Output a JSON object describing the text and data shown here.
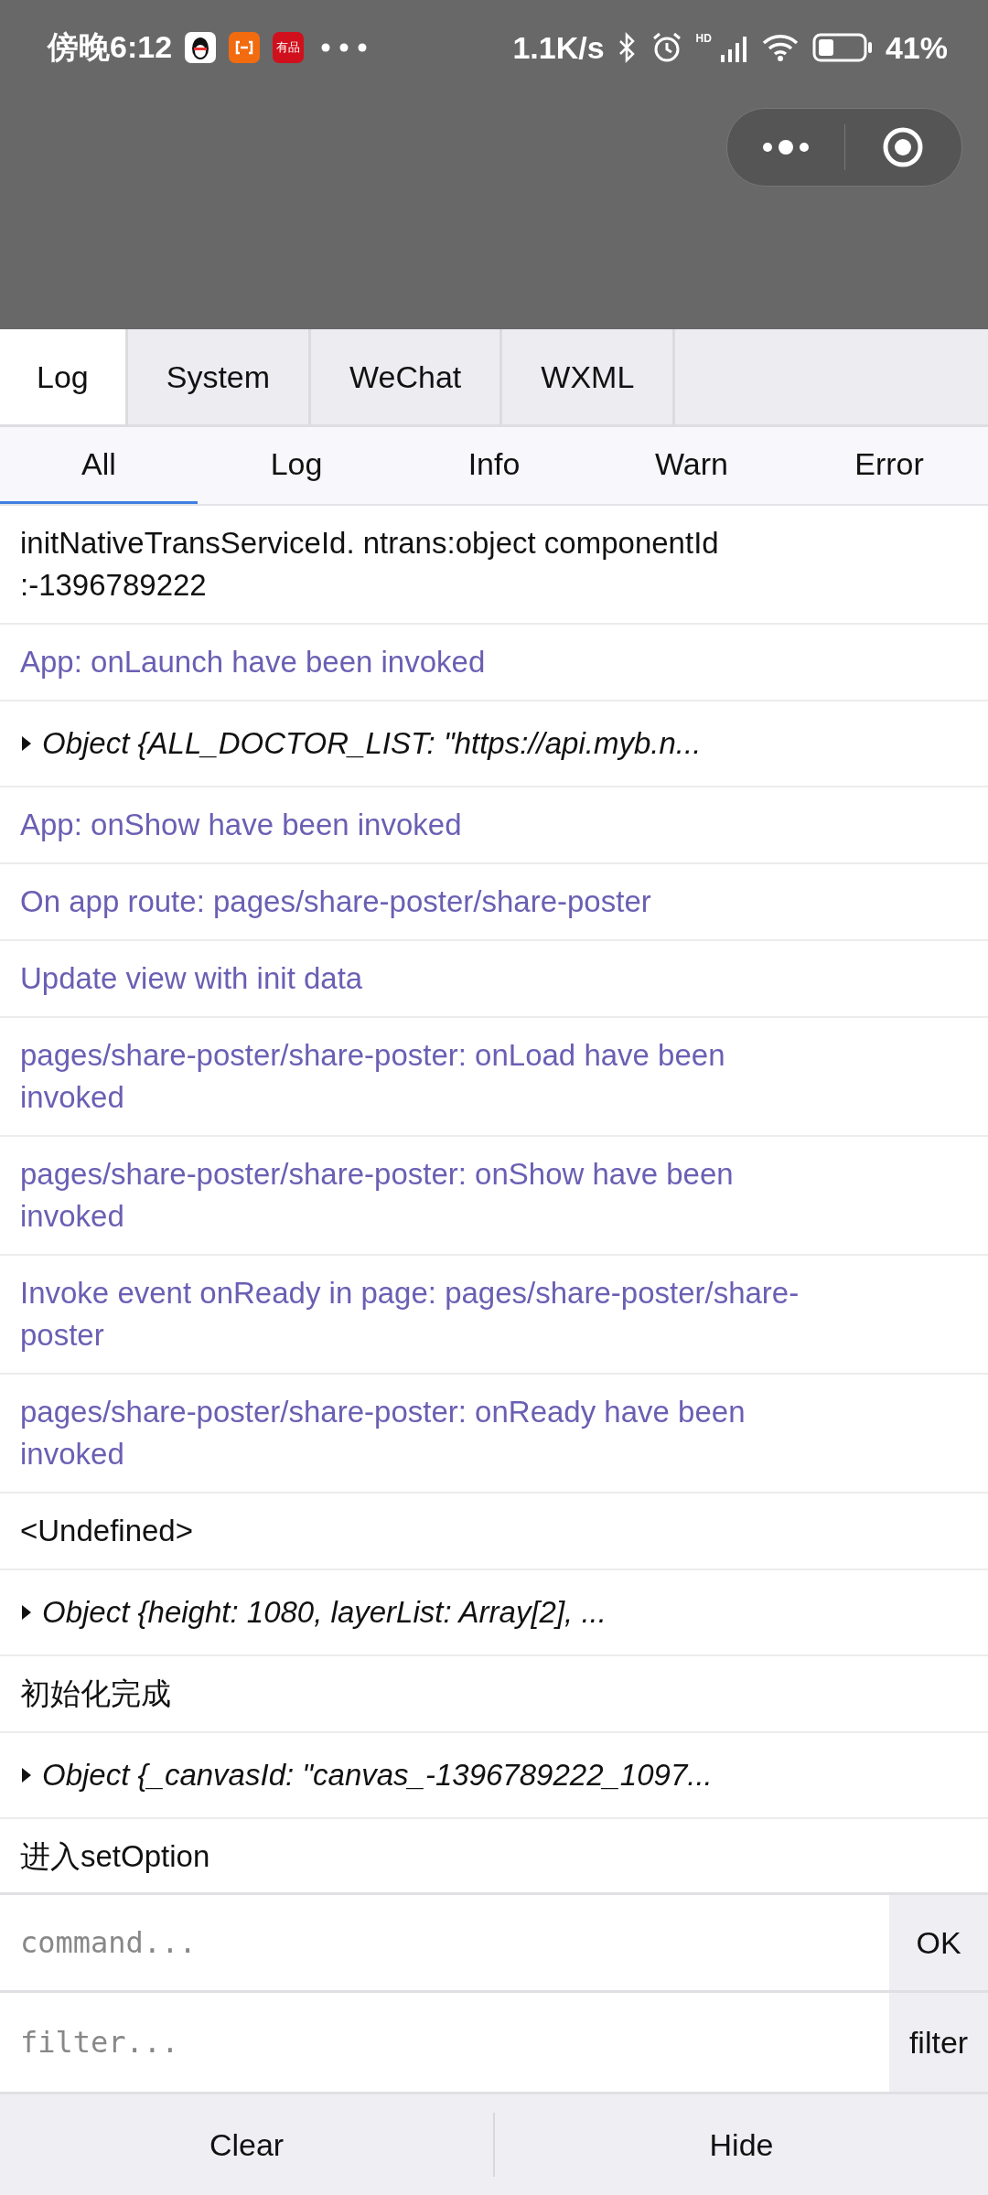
{
  "status_bar": {
    "time": "傍晚6:12",
    "app_badge": "有品",
    "speed": "1.1K/s",
    "signal_label": "HD",
    "battery": "41%"
  },
  "tabs": [
    {
      "label": "Log",
      "selected": true
    },
    {
      "label": "System",
      "selected": false
    },
    {
      "label": "WeChat",
      "selected": false
    },
    {
      "label": "WXML",
      "selected": false
    }
  ],
  "filters": [
    {
      "label": "All",
      "selected": true
    },
    {
      "label": "Log",
      "selected": false
    },
    {
      "label": "Info",
      "selected": false
    },
    {
      "label": "Warn",
      "selected": false
    },
    {
      "label": "Error",
      "selected": false
    }
  ],
  "log": [
    {
      "kind": "plain",
      "text": "initNativeTransServiceId. ntrans:object componentId :-1396789222"
    },
    {
      "kind": "system",
      "text": "App: onLaunch have been invoked"
    },
    {
      "kind": "object",
      "text": "Object {ALL_DOCTOR_LIST: \"https://api.myb.n..."
    },
    {
      "kind": "system",
      "text": "App: onShow have been invoked"
    },
    {
      "kind": "system",
      "text": "On app route: pages/share-poster/share-poster"
    },
    {
      "kind": "system",
      "text": "Update view with init data"
    },
    {
      "kind": "system",
      "text": "pages/share-poster/share-poster: onLoad have been invoked"
    },
    {
      "kind": "system",
      "text": "pages/share-poster/share-poster: onShow have been invoked"
    },
    {
      "kind": "system",
      "text": "Invoke event onReady in page: pages/share-poster/share-poster"
    },
    {
      "kind": "system",
      "text": "pages/share-poster/share-poster: onReady have been invoked"
    },
    {
      "kind": "plain",
      "text": "<Undefined>"
    },
    {
      "kind": "object",
      "text": "Object {height: 1080, layerList: Array[2], ..."
    },
    {
      "kind": "plain",
      "text": "初始化完成"
    },
    {
      "kind": "object",
      "text": "Object {_canvasId: \"canvas_-1396789222_1097..."
    },
    {
      "kind": "plain",
      "text": "进入setOption"
    }
  ],
  "command": {
    "placeholder": "command...",
    "button": "OK"
  },
  "filter": {
    "placeholder": "filter...",
    "button": "filter"
  },
  "footer": [
    "Clear",
    "Hide"
  ]
}
